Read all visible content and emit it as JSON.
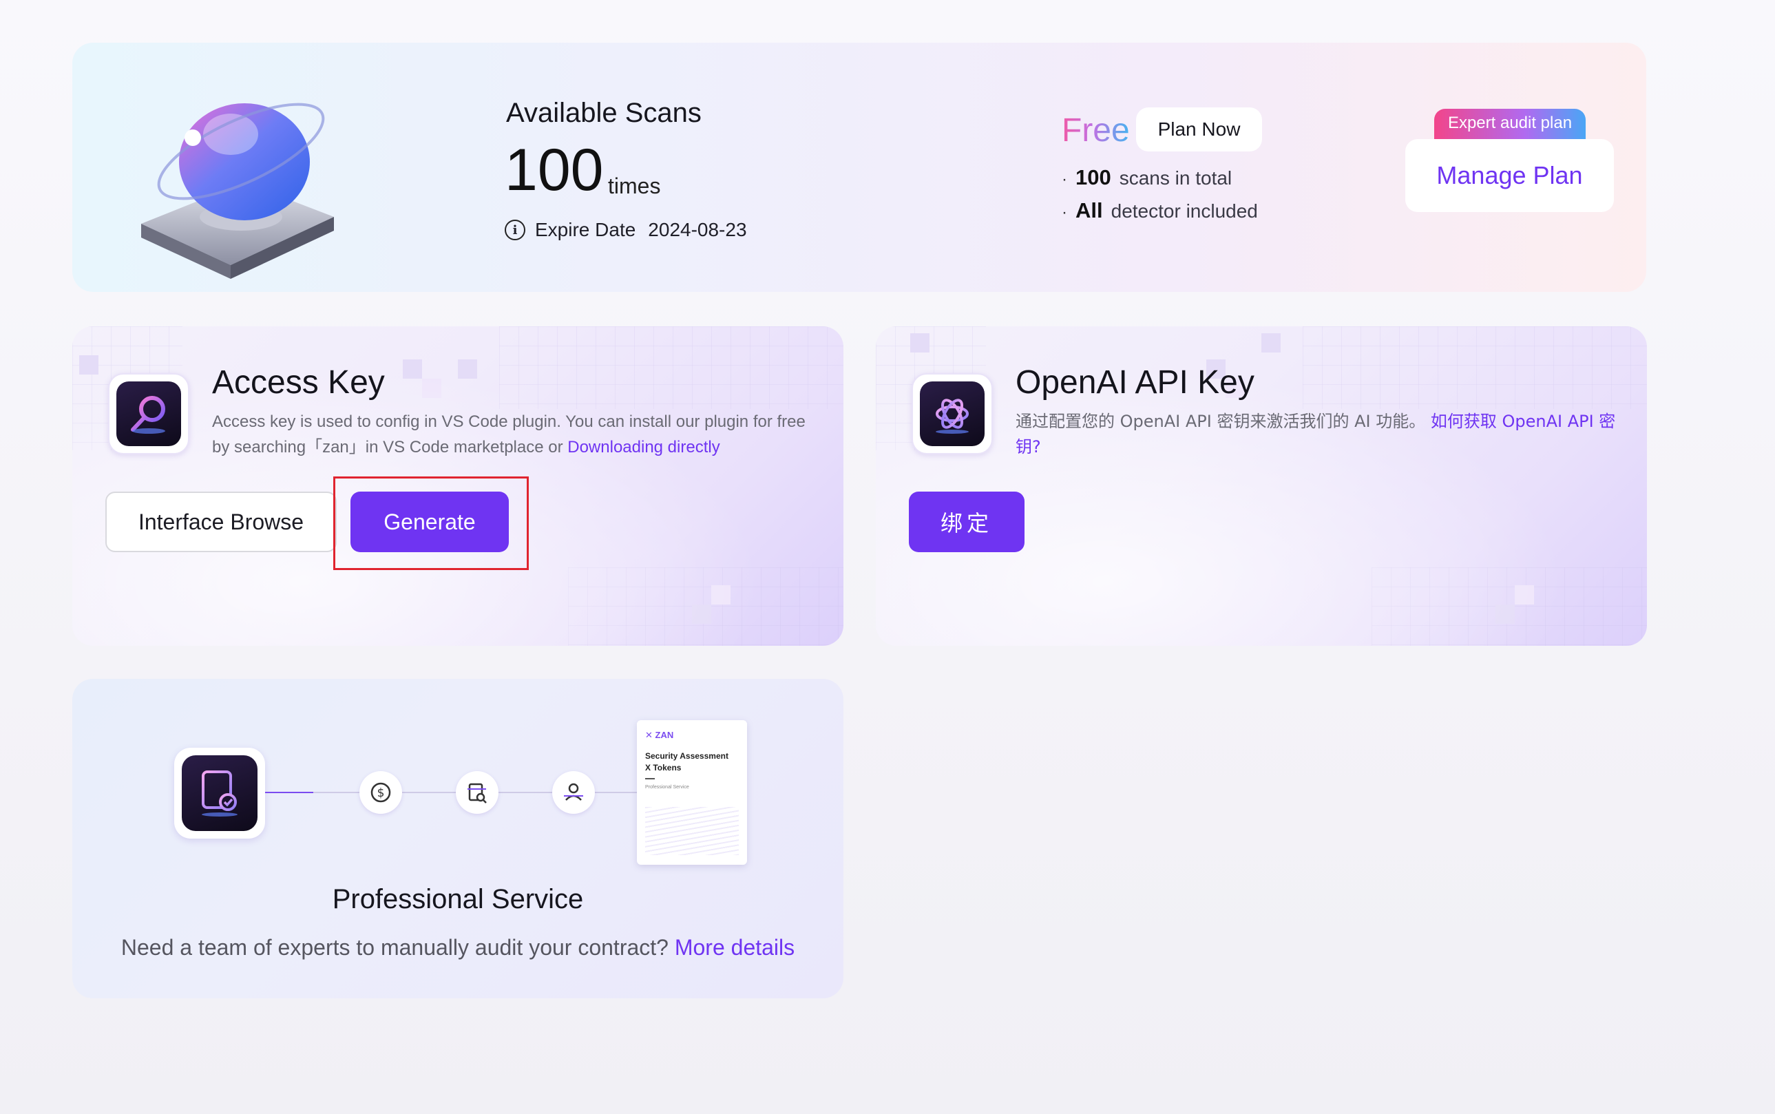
{
  "scans": {
    "title": "Available Scans",
    "count": "100",
    "unit": "times",
    "expire_label": "Expire Date",
    "expire_date": "2024-08-23"
  },
  "plan": {
    "name": "Free",
    "plan_now_label": "Plan Now",
    "features": [
      {
        "value": "100",
        "text": "scans in total"
      },
      {
        "value": "All",
        "text": "detector included"
      }
    ],
    "expert_tag": "Expert audit plan",
    "manage_label": "Manage Plan"
  },
  "access_key": {
    "title": "Access Key",
    "desc": "Access key is used to config in VS Code plugin. You can install our plugin for free by searching「zan」in VS Code marketplace or",
    "desc_link": "Downloading directly",
    "browse_label": "Interface Browse",
    "generate_label": "Generate"
  },
  "openai": {
    "title": "OpenAI API Key",
    "desc": "通过配置您的 OpenAI API 密钥来激活我们的 AI 功能。",
    "desc_link": "如何获取 OpenAI API 密钥?",
    "bind_label": "绑定"
  },
  "service": {
    "title": "Professional Service",
    "desc": "Need a team of experts to manually audit your contract?",
    "desc_link": "More details",
    "report_brand": "ZAN",
    "report_title_1": "Security Assessment",
    "report_title_2": "X Tokens",
    "report_sub": "Professional Service"
  },
  "colors": {
    "accent": "#6f34f2",
    "highlight": "#e0242f"
  }
}
